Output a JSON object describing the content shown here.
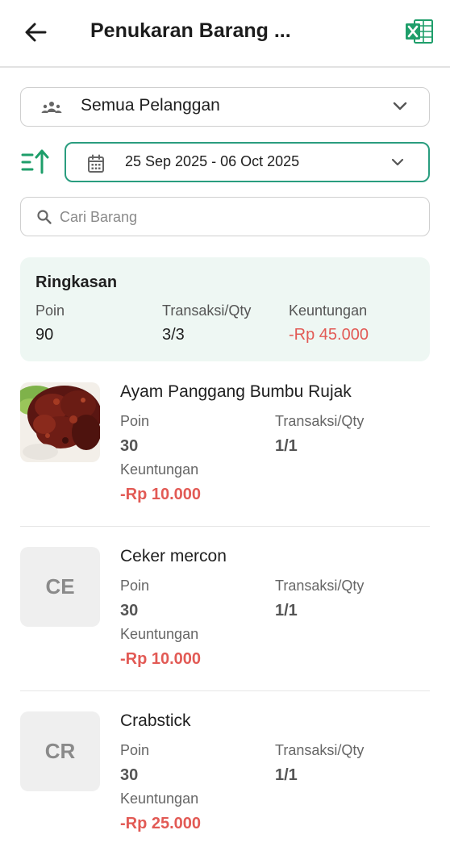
{
  "header": {
    "title": "Penukaran Barang ...",
    "back_icon": "arrow-left-icon",
    "export_icon": "excel-icon",
    "brand_color": "#1e9e6a"
  },
  "filters": {
    "customer": "Semua Pelanggan",
    "date_range": "25 Sep 2025 - 06 Oct 2025",
    "accent_color": "#2a9d7f"
  },
  "search": {
    "placeholder": "Cari Barang",
    "value": ""
  },
  "summary": {
    "title": "Ringkasan",
    "poin_label": "Poin",
    "poin": "90",
    "transaksi_label": "Transaksi/Qty",
    "transaksi": "3/3",
    "keuntungan_label": "Keuntungan",
    "keuntungan": "-Rp 45.000",
    "negative_color": "#e25a55"
  },
  "items": [
    {
      "name": "Ayam Panggang Bumbu Rujak",
      "image": "grilled-chicken-photo",
      "initials": "",
      "poin_label": "Poin",
      "poin": "30",
      "transaksi_label": "Transaksi/Qty",
      "transaksi": "1/1",
      "keuntungan_label": "Keuntungan",
      "keuntungan": "-Rp 10.000"
    },
    {
      "name": "Ceker mercon",
      "image": "",
      "initials": "CE",
      "poin_label": "Poin",
      "poin": "30",
      "transaksi_label": "Transaksi/Qty",
      "transaksi": "1/1",
      "keuntungan_label": "Keuntungan",
      "keuntungan": "-Rp 10.000"
    },
    {
      "name": "Crabstick",
      "image": "",
      "initials": "CR",
      "poin_label": "Poin",
      "poin": "30",
      "transaksi_label": "Transaksi/Qty",
      "transaksi": "1/1",
      "keuntungan_label": "Keuntungan",
      "keuntungan": "-Rp 25.000"
    }
  ]
}
